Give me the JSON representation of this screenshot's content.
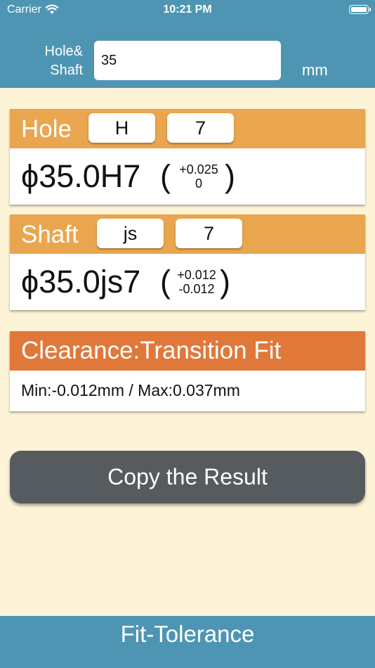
{
  "status_bar": {
    "carrier": "Carrier",
    "time": "10:21 PM"
  },
  "header": {
    "input_label_line1": "Hole&",
    "input_label_line2": "Shaft",
    "size_value": "35",
    "unit": "mm"
  },
  "hole": {
    "title": "Hole",
    "grade_letter": "H",
    "grade_number": "7",
    "designation": "ϕ35.0H7",
    "upper_deviation": "+0.025",
    "lower_deviation": "0",
    "open_paren": "(",
    "close_paren": ")"
  },
  "shaft": {
    "title": "Shaft",
    "grade_letter": "js",
    "grade_number": "7",
    "designation": "ϕ35.0js7",
    "upper_deviation": "+0.012",
    "lower_deviation": "-0.012",
    "open_paren": "(",
    "close_paren": ")"
  },
  "result": {
    "title": "Clearance:Transition Fit",
    "range_text": "Min:-0.012mm / Max:0.037mm"
  },
  "actions": {
    "copy_label": "Copy the Result"
  },
  "footer": {
    "title": "Fit-Tolerance"
  },
  "colors": {
    "header_blue": "#4e95b3",
    "card_orange": "#eaa54f",
    "result_orange": "#e0783a",
    "button_gray": "#565b60",
    "background_cream": "#fdf4d8"
  }
}
